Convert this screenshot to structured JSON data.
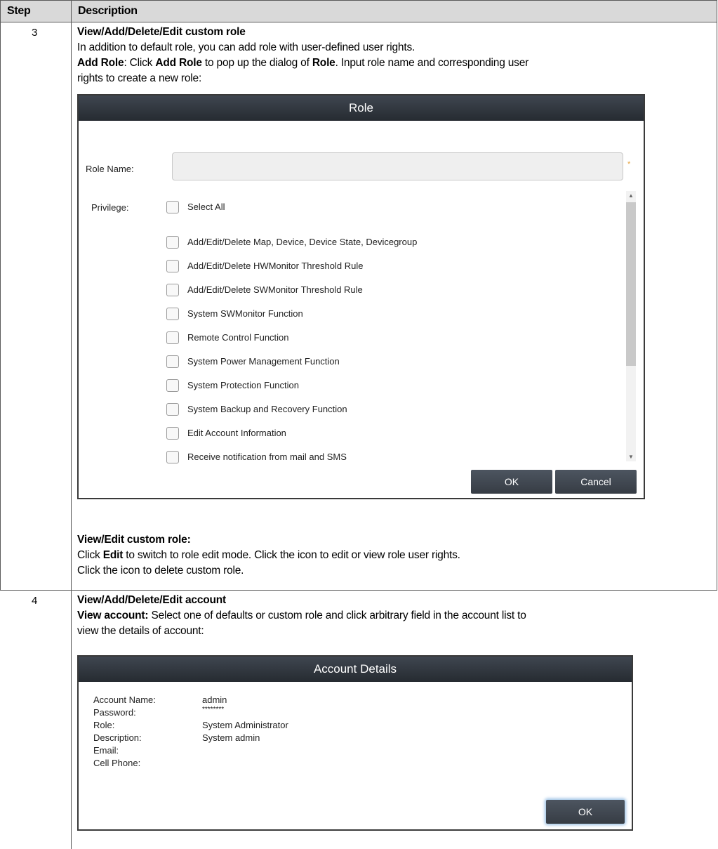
{
  "table": {
    "header": {
      "step": "Step",
      "description": "Description"
    },
    "row3": {
      "step": "3",
      "heading": "View/Add/Delete/Edit custom role",
      "intro": "In addition to default role, you can add role with user-defined user rights.",
      "add_role_line1": {
        "lead": "Add Role",
        "t1": ": Click ",
        "b1": "Add Role",
        "t2": " to pop up the dialog of ",
        "b2": "Role",
        "t3": ". Input role name and corresponding user"
      },
      "add_role_line2": "rights to create a new role:",
      "view_edit_heading": "View/Edit custom role:",
      "view_edit_line1": {
        "t0": "Click ",
        "b1": "Edit",
        "t1": " to switch to role edit mode. Click the icon to edit or view role user rights."
      },
      "view_edit_line2": "Click the icon to delete custom role."
    },
    "row4": {
      "step": "4",
      "heading": "View/Add/Delete/Edit account",
      "view_account_line1": {
        "lead": "View account:",
        "t1": " Select one of defaults or custom role and click arbitrary field in the account list to"
      },
      "view_account_line2": "view the details of account:"
    }
  },
  "role_dialog": {
    "title": "Role",
    "role_name_label": "Role Name:",
    "required_mark": "*",
    "privilege_label": "Privilege:",
    "select_all": "Select All",
    "privileges": [
      "Add/Edit/Delete Map, Device, Device State, Devicegroup",
      "Add/Edit/Delete HWMonitor Threshold Rule",
      "Add/Edit/Delete SWMonitor Threshold Rule",
      "System SWMonitor Function",
      "Remote Control Function",
      "System Power Management Function",
      "System Protection Function",
      "System Backup and Recovery Function",
      "Edit Account Information",
      "Receive notification from mail and SMS"
    ],
    "ok": "OK",
    "cancel": "Cancel"
  },
  "account_dialog": {
    "title": "Account Details",
    "fields": [
      {
        "label": "Account Name:",
        "value": "admin"
      },
      {
        "label": "Password:",
        "value": "********"
      },
      {
        "label": "Role:",
        "value": "System Administrator"
      },
      {
        "label": "Description:",
        "value": "System admin"
      },
      {
        "label": "Email:",
        "value": ""
      },
      {
        "label": "Cell Phone:",
        "value": ""
      }
    ],
    "ok": "OK"
  }
}
